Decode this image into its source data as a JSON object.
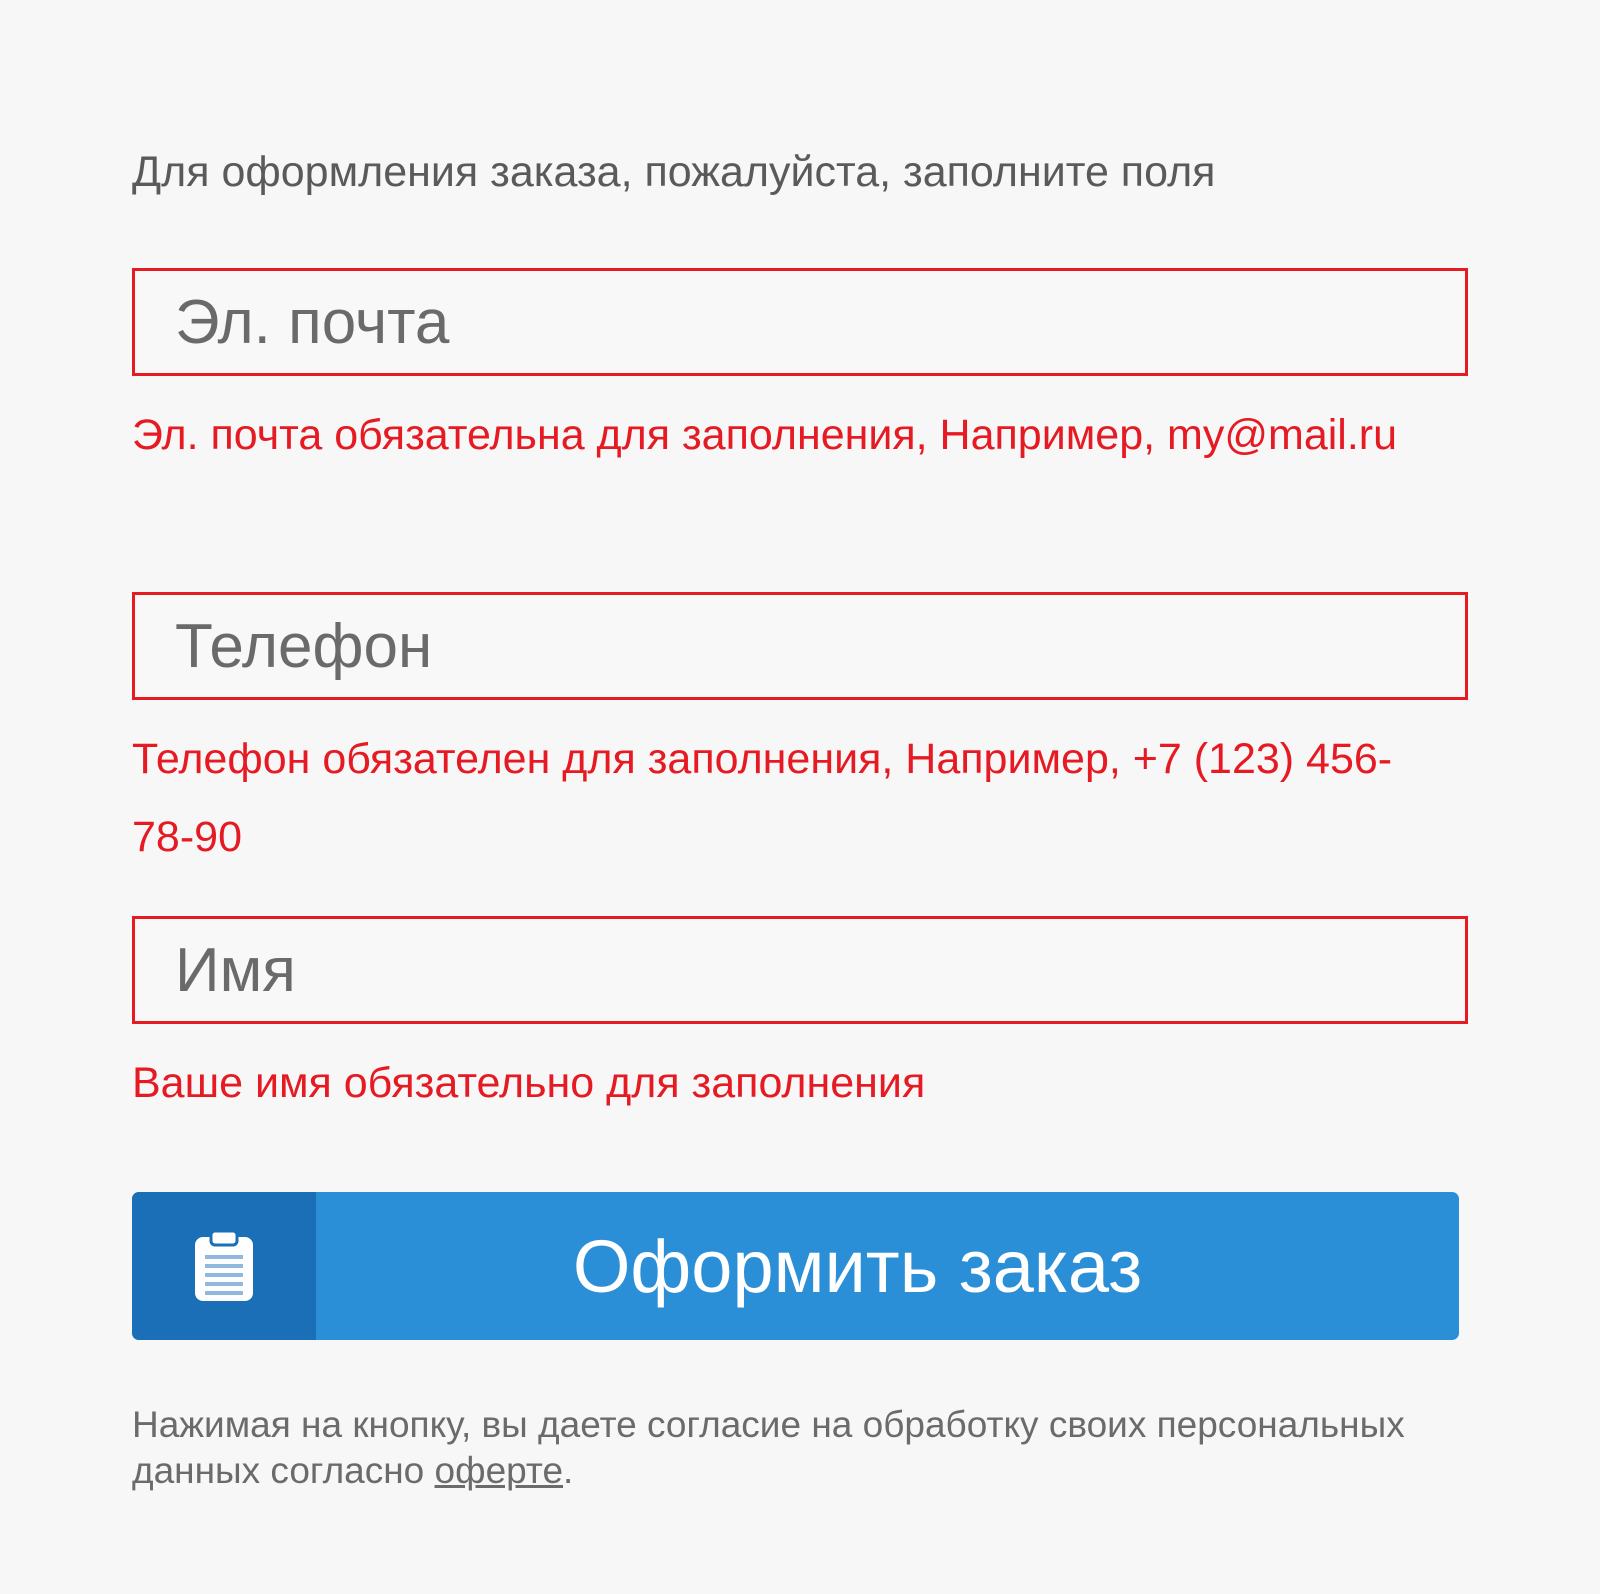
{
  "form": {
    "intro_text": "Для оформления заказа, пожалуйста, заполните поля",
    "email": {
      "placeholder": "Эл. почта",
      "value": "",
      "error": "Эл. почта обязательна для заполнения, Например, my@mail.ru"
    },
    "phone": {
      "placeholder": "Телефон",
      "value": "",
      "error": "Телефон обязателен для заполнения, Например, +7 (123) 456-78-90"
    },
    "name": {
      "placeholder": "Имя",
      "value": "",
      "error": "Ваше имя обязательно для заполнения"
    },
    "submit": {
      "label": "Оформить заказ",
      "icon": "clipboard-icon"
    },
    "consent": {
      "text_before": "Нажимая на кнопку, вы даете согласие на обработку своих персональных данных согласно ",
      "link_text": "оферте",
      "text_after": "."
    }
  },
  "colors": {
    "error": "#e51a22",
    "button": "#2b8fd7",
    "button_icon_bg": "#1a6fb6",
    "background": "#f7f7f7",
    "muted_text": "#5a5a5a"
  }
}
